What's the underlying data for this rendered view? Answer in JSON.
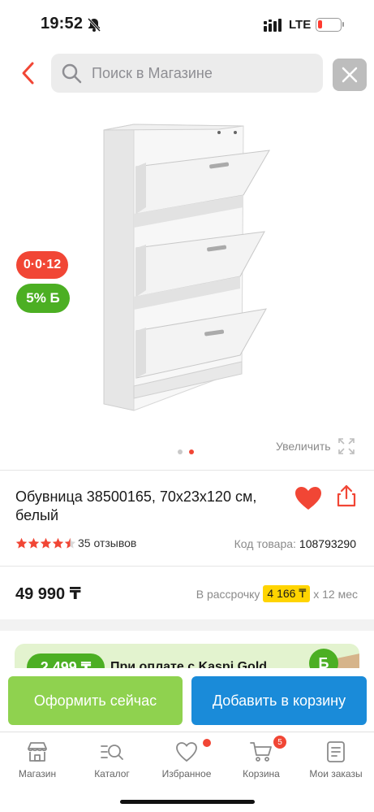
{
  "status": {
    "time": "19:52",
    "network": "LTE",
    "battery_level": 0.2
  },
  "header": {
    "search_placeholder": "Поиск в Магазине"
  },
  "product": {
    "timer_badge": "0·0·12",
    "bonus_badge": "5% Б",
    "zoom_label": "Увеличить",
    "image_count": 2,
    "active_image": 2,
    "title": "Обувница 38500165, 70x23x120 см, белый",
    "rating": 4.5,
    "reviews": "35 отзывов",
    "code_label": "Код товара:",
    "code_value": "108793290",
    "price": "49 990 ₸",
    "installment_prefix": "В рассрочку",
    "installment_amount": "4 166 ₸",
    "installment_suffix": "х 12 мес"
  },
  "promo": {
    "pill": "2 499 ₸",
    "text": "При оплате с Kaspi Gold",
    "coin": "Б"
  },
  "actions": {
    "order_label": "Оформить сейчас",
    "cart_label": "Добавить в корзину"
  },
  "nav": {
    "items": [
      {
        "label": "Магазин",
        "icon": "store-icon"
      },
      {
        "label": "Каталог",
        "icon": "catalog-icon"
      },
      {
        "label": "Избранное",
        "icon": "heart-icon"
      },
      {
        "label": "Корзина",
        "icon": "cart-icon",
        "badge": "5"
      },
      {
        "label": "Мои заказы",
        "icon": "orders-icon"
      }
    ]
  },
  "colors": {
    "accent_red": "#f14635",
    "bonus_green": "#4caf23",
    "order_button": "#8fd24f",
    "cart_button": "#1a8bd9",
    "installment_highlight": "#ffd400"
  }
}
